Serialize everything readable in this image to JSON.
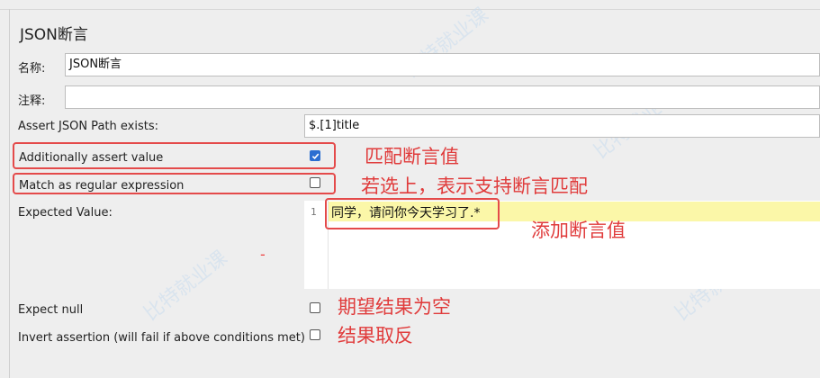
{
  "title": "JSON断言",
  "name": {
    "label": "名称:",
    "value": "JSON断言"
  },
  "comment": {
    "label": "注释:",
    "value": ""
  },
  "path": {
    "label": "Assert JSON Path exists:",
    "value": "$.[1]title"
  },
  "additionally": {
    "label": "Additionally assert value",
    "checked": true
  },
  "regex": {
    "label": "Match as regular expression",
    "checked": false
  },
  "expected": {
    "label": "Expected Value:",
    "line_number": "1",
    "code": "同学，请问你今天学习了.*"
  },
  "expect_null": {
    "label": "Expect null",
    "checked": false
  },
  "invert": {
    "label": "Invert assertion (will fail if above conditions met)",
    "checked": false
  },
  "annotations": {
    "match_value": "匹配断言值",
    "regex_support": "若选上，表示支持断言匹配",
    "add_value": "添加断言值",
    "expect_empty": "期望结果为空",
    "invert_result": "结果取反",
    "dash": "-"
  },
  "watermark": "比特就业课",
  "colors": {
    "annotation": "#e03b3b",
    "checkbox_checked": "#2b6ed1",
    "line_highlight": "#fbf7a8"
  }
}
